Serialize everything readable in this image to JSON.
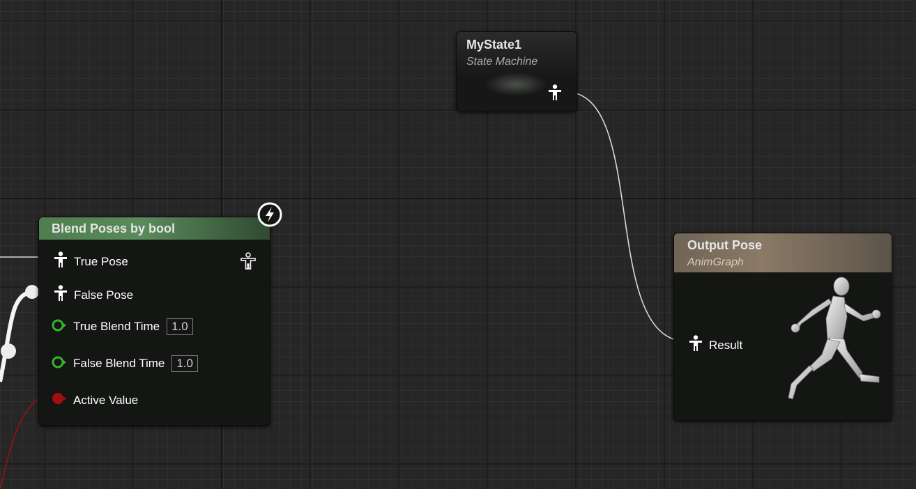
{
  "colors": {
    "canvas_bg": "#262626",
    "blend_header": "#4f7d50",
    "output_header": "#8a7a66",
    "float_pin": "#35b52a",
    "bool_pin": "#a10f0f",
    "wire": "#d9d9d9"
  },
  "state_node": {
    "title": "MyState1",
    "subtitle": "State Machine",
    "output_pin_icon": "pose-pin-icon"
  },
  "blend_node": {
    "title": "Blend Poses by bool",
    "corner_icon": "lightning-bolt-icon",
    "output_pin_icon": "pose-outline-icon",
    "pins": [
      {
        "label": "True Pose",
        "type": "pose",
        "icon": "pose-pin-icon"
      },
      {
        "label": "False Pose",
        "type": "pose",
        "icon": "pose-pin-icon"
      },
      {
        "label": "True Blend Time",
        "type": "float",
        "value": "1.0",
        "icon": "float-pin-icon"
      },
      {
        "label": "False Blend Time",
        "type": "float",
        "value": "1.0",
        "icon": "float-pin-icon"
      },
      {
        "label": "Active Value",
        "type": "bool",
        "icon": "bool-pin-icon"
      }
    ]
  },
  "output_node": {
    "title": "Output Pose",
    "subtitle": "AnimGraph",
    "pin_label": "Result",
    "pin_icon": "pose-pin-icon",
    "figure_icon": "running-mannequin-icon"
  }
}
